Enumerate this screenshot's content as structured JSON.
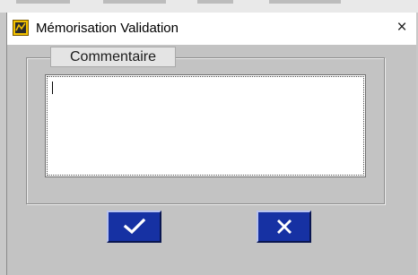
{
  "window": {
    "title": "Mémorisation Validation",
    "close_glyph": "×",
    "icon": "app-icon"
  },
  "comment_group": {
    "label": "Commentaire",
    "textarea": {
      "value": "",
      "placeholder": ""
    }
  },
  "buttons": {
    "ok": {
      "icon": "checkmark-icon"
    },
    "cancel": {
      "icon": "cross-icon"
    }
  },
  "colors": {
    "button_blue": "#1631a3",
    "dialog_bg": "#c3c3c3",
    "icon_yellow": "#f2c100"
  }
}
